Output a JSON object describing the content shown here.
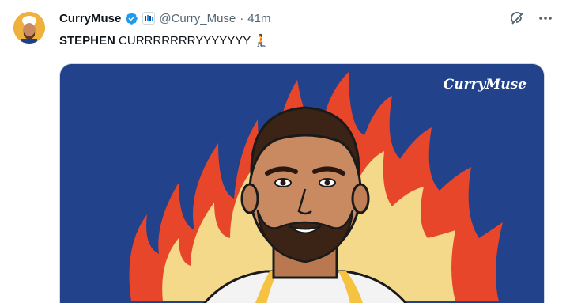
{
  "tweet": {
    "display_name": "CurryMuse",
    "handle": "@Curry_Muse",
    "separator": "·",
    "time": "41m",
    "text_bold": "STEPHEN",
    "text_rest": " CURRRRRRRYYYYYYY ",
    "text_emoji": "🧎"
  },
  "media": {
    "watermark": "CurryMuse"
  },
  "icons": {
    "verified": "verified-badge-icon",
    "affiliation": "affiliation-badge-icon",
    "grok": "grok-icon",
    "more": "more-icon"
  },
  "colors": {
    "verified": "#1d9bf0",
    "media_background": "#22428c",
    "flame_outer": "#e8462a",
    "flame_inner": "#f5d98a"
  }
}
